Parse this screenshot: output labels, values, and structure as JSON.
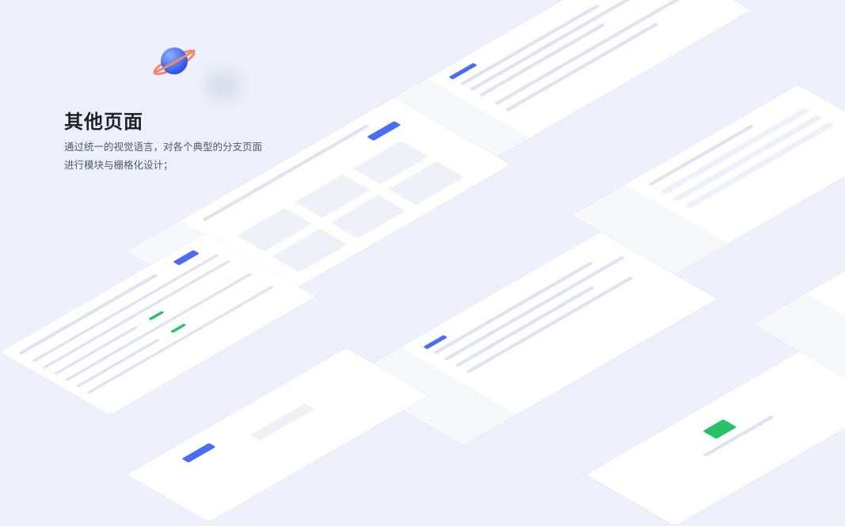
{
  "page": {
    "heading": "其他页面",
    "description_lines": [
      "通过统一的视觉语言，对各个典型的分支页面",
      "进行模块与栅格化设计；"
    ]
  },
  "colors": {
    "background": "#eef1fb",
    "heading": "#1d2129",
    "text": "#4e5969",
    "accent_blue": "#4a6cf7",
    "planet_ring": "#f08a6b"
  },
  "icons": {
    "planet": "planet-icon"
  }
}
